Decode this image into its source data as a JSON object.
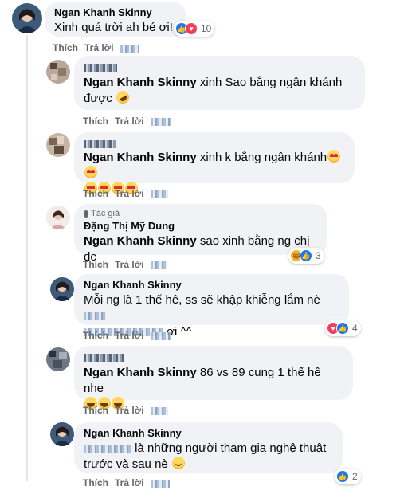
{
  "colors": {
    "bubble": "#f0f2f5",
    "action_text": "#65676b",
    "like": "#1877f2",
    "love": "#f33e58"
  },
  "actions": {
    "like": "Thích",
    "reply": "Trả lời"
  },
  "top_comment": {
    "author": "Ngan Khanh Skinny",
    "text": "Xinh quá trời ah bé ơi!",
    "reaction_count": "10",
    "reaction_icons": [
      "like-icon",
      "love-icon"
    ]
  },
  "replies": [
    {
      "mention": "Ngan Khanh Skinny",
      "text": " xinh Sao bằng ngân khánh được",
      "emoji": [
        "rofl"
      ]
    },
    {
      "mention": "Ngan Khanh Skinny",
      "text": " xinh k bằng ngân khánh",
      "emoji": [
        "heart-eyes",
        "heart-eyes",
        "heart-eyes",
        "heart-eyes",
        "heart-eyes",
        "heart-eyes"
      ]
    },
    {
      "badge": "Tác giả",
      "author": "Đặng Thị Mỹ Dung",
      "mention": "Ngan Khanh Skinny",
      "text": " sao xinh bằng ng chị dc",
      "reaction_count": "3",
      "reaction_icons": [
        "haha-icon",
        "like-icon"
      ]
    },
    {
      "author": "Ngan Khanh Skinny",
      "text_a": "Mỗi ng là 1 thế hê, ss sẽ khập khiễng lắm nè",
      "text_b": " ơi ^^",
      "reaction_count": "4",
      "reaction_icons": [
        "love-icon",
        "like-icon"
      ]
    },
    {
      "mention": "Ngan Khanh Skinny",
      "text": " 86 vs 89 cung 1 thế hê nhe",
      "emoji": [
        "laugh",
        "laugh",
        "laugh"
      ]
    },
    {
      "author": "Ngan Khanh Skinny",
      "text": " là những người tham gia nghệ thuật trước và sau nè",
      "emoji": [
        "smile"
      ],
      "reaction_count": "2",
      "reaction_icons": [
        "like-icon"
      ]
    }
  ]
}
